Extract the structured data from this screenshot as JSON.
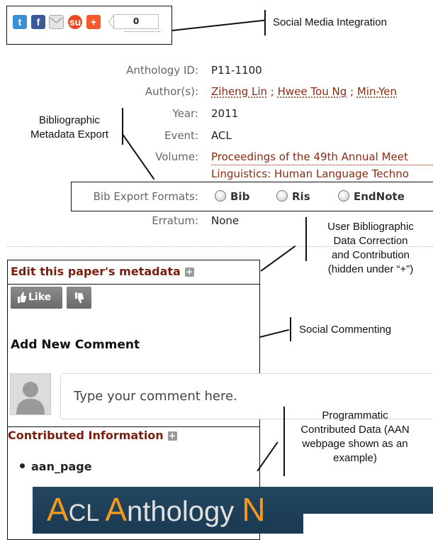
{
  "social": {
    "share_count": "0",
    "icons": [
      "twitter-icon",
      "facebook-icon",
      "email-icon",
      "stumbleupon-icon",
      "addthis-plus-icon"
    ],
    "colors": {
      "twitter": "#3b8fd1",
      "facebook": "#3b5998",
      "stumbleupon": "#eb4924",
      "addthis": "#f4592c"
    }
  },
  "metadata": {
    "anthology_id_label": "Anthology ID:",
    "anthology_id": "P11-1100",
    "authors_label": "Author(s):",
    "authors": [
      "Ziheng Lin",
      "Hwee Tou Ng",
      "Min-Yen"
    ],
    "author_sep": ";",
    "year_label": "Year:",
    "year": "2011",
    "event_label": "Event:",
    "event": "ACL",
    "volume_label": "Volume:",
    "volume_line1": "Proceedings of the 49th Annual Meet",
    "volume_line2": "Linguistics: Human Language Techno",
    "bib_label": "Bib Export Formats:",
    "formats": [
      "Bib",
      "Ris",
      "EndNote"
    ],
    "erratum_label": "Erratum:",
    "erratum": "None"
  },
  "edit": {
    "title": "Edit this paper's metadata",
    "plus": "+"
  },
  "vote": {
    "like": "Like"
  },
  "comments": {
    "title": "Add New Comment",
    "placeholder": "Type your comment here."
  },
  "contributed": {
    "title": "Contributed Information",
    "item": "aan_page",
    "banner": [
      "A",
      "CL ",
      "A",
      "nthology ",
      "N"
    ]
  },
  "callouts": {
    "social_media": "Social Media Integration",
    "bib_export": [
      "Bibliographic",
      "Metadata Export"
    ],
    "user_correction": [
      "User Bibliographic",
      "Data Correction",
      "and Contribution",
      "(hidden under “+”)"
    ],
    "social_commenting": "Social Commenting",
    "programmatic": [
      "Programmatic",
      "Contributed Data (AAN",
      "webpage shown as an",
      "example)"
    ]
  }
}
